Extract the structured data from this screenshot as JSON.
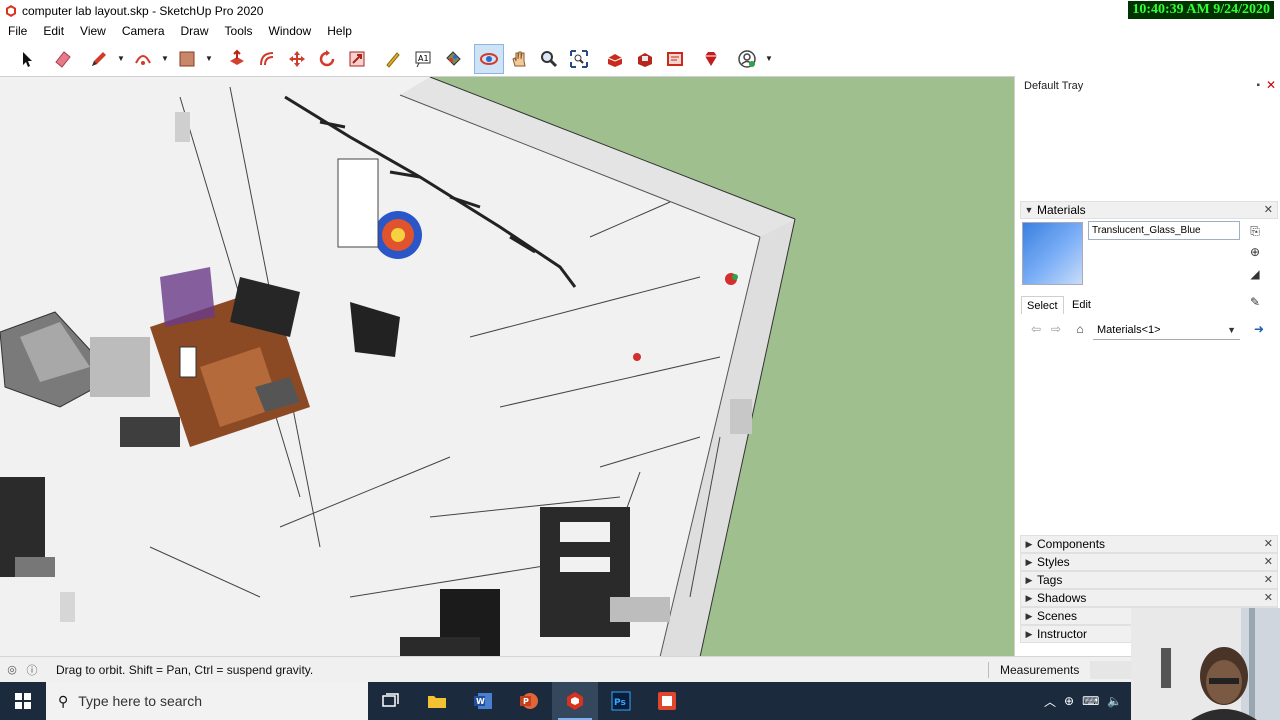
{
  "window": {
    "title": "computer lab layout.skp - SketchUp Pro 2020",
    "clock": "10:40:39 AM 9/24/2020"
  },
  "menu": [
    "File",
    "Edit",
    "View",
    "Camera",
    "Draw",
    "Tools",
    "Window",
    "Help"
  ],
  "toolbar": {
    "tools": [
      "select-icon",
      "eraser-icon",
      "pencil-icon",
      "arc-icon",
      "rectangle-icon",
      "push-pull-icon",
      "offset-icon",
      "move-icon",
      "rotate-icon",
      "scale-icon",
      "tape-measure-icon",
      "text-icon",
      "paint-bucket-icon",
      "orbit-icon",
      "pan-icon",
      "zoom-icon",
      "zoom-extents-icon",
      "3d-warehouse-icon",
      "extension-warehouse-icon",
      "layout-icon",
      "ruby-icon",
      "account-icon"
    ],
    "active_tool": "orbit-icon"
  },
  "tray": {
    "title": "Default Tray",
    "materials": {
      "header": "Materials",
      "current_material": "Translucent_Glass_Blue",
      "swatch_color": "#5a96ea",
      "tabs": [
        "Select",
        "Edit"
      ],
      "selected_tab": "Select",
      "collection": "Materials<1>"
    },
    "collapsed_panels": [
      "Components",
      "Styles",
      "Tags",
      "Shadows",
      "Scenes",
      "Instructor"
    ]
  },
  "statusbar": {
    "hint": "Drag to orbit. Shift = Pan, Ctrl = suspend gravity.",
    "measurements_label": "Measurements"
  },
  "taskbar": {
    "search_placeholder": "Type here to search",
    "apps": [
      "task-view-icon",
      "file-explorer-icon",
      "word-icon",
      "powerpoint-icon",
      "sketchup-icon",
      "photoshop-icon",
      "layout-icon"
    ],
    "active_app": "sketchup-icon"
  },
  "colors": {
    "sky": "#9fbf8f",
    "clock_bg": "#003300",
    "clock_fg": "#33ff33",
    "taskbar": "#1b2a3c"
  }
}
